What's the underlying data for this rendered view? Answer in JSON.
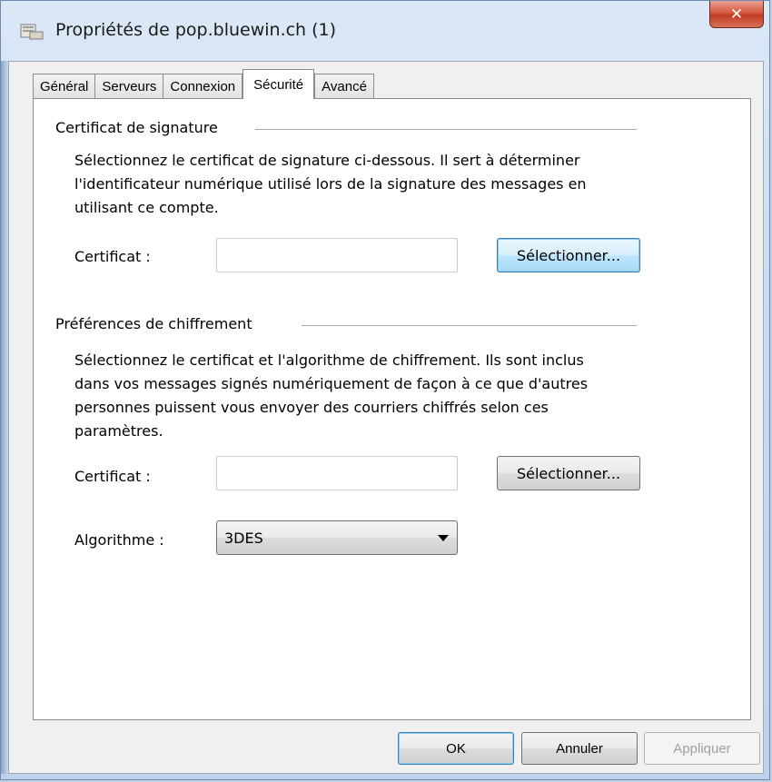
{
  "window": {
    "title": "Propriétés de pop.bluewin.ch (1)",
    "close_icon": "close-icon",
    "app_icon": "account-properties-icon"
  },
  "tabs": [
    {
      "label": "Général"
    },
    {
      "label": "Serveurs"
    },
    {
      "label": "Connexion"
    },
    {
      "label": "Sécurité",
      "active": true
    },
    {
      "label": "Avancé"
    }
  ],
  "signing": {
    "heading": "Certificat de signature",
    "description_lines": [
      "Sélectionnez le certificat de signature ci-dessous. Il sert à déterminer",
      "l'identificateur numérique utilisé lors de la signature des messages en",
      "utilisant ce compte."
    ],
    "certificate_label": "Certificat :",
    "certificate_value": "",
    "select_button": "Sélectionner..."
  },
  "encryption": {
    "heading": "Préférences de chiffrement",
    "description_lines": [
      "Sélectionnez le certificat et l'algorithme de chiffrement. Ils sont inclus",
      "dans vos messages signés numériquement de façon à ce que d'autres",
      "personnes puissent vous envoyer des courriers chiffrés selon ces",
      "paramètres."
    ],
    "certificate_label": "Certificat :",
    "certificate_value": "",
    "select_button": "Sélectionner...",
    "algorithm_label": "Algorithme :",
    "algorithm_value": "3DES"
  },
  "footer": {
    "ok": "OK",
    "cancel": "Annuler",
    "apply": "Appliquer"
  },
  "colors": {
    "close_button": "#c94a30",
    "focus_button": "#3c7fb1"
  }
}
